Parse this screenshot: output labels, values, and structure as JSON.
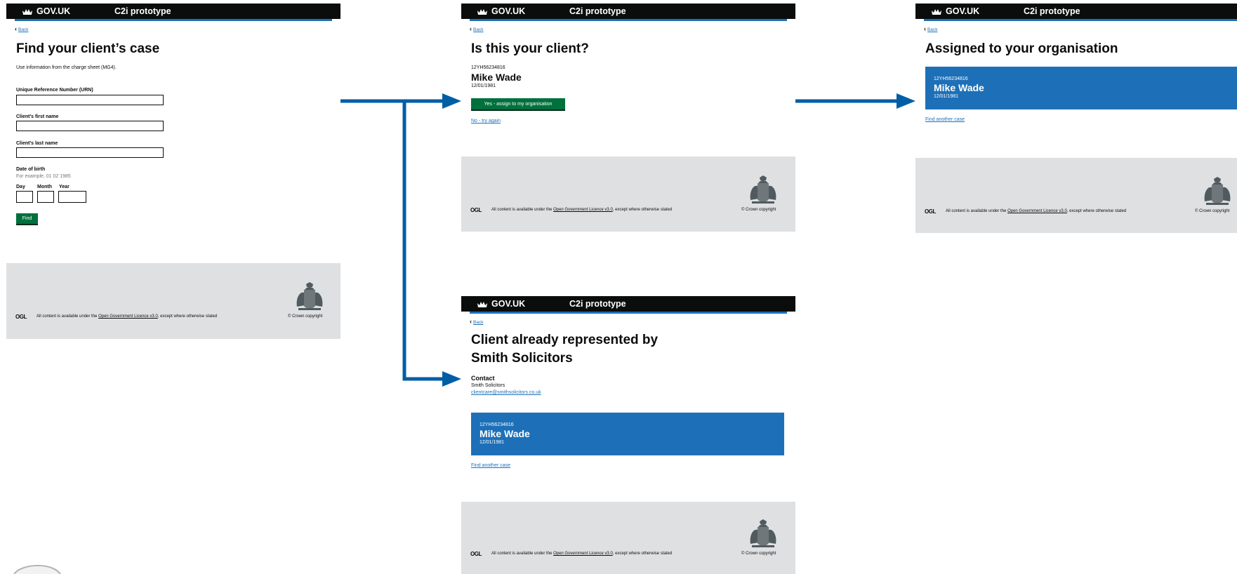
{
  "common": {
    "logo": "GOV.UK",
    "service": "C2i prototype",
    "back": "Back",
    "ogl": "OGL",
    "licence_before": "All content is available under the ",
    "licence_link": "Open Government Licence v3.0",
    "licence_after": ", except where otherwise stated",
    "copyright": "© Crown copyright"
  },
  "find_screen": {
    "title": "Find your client’s case",
    "intro": "Use information from the charge sheet (MG4).",
    "urn_label": "Unique Reference Number (URN)",
    "first_name_label": "Client’s first name",
    "last_name_label": "Client’s last name",
    "dob_label": "Date of birth",
    "dob_hint": "For example, 01 02 1985",
    "day_label": "Day",
    "month_label": "Month",
    "year_label": "Year",
    "find_button": "Find"
  },
  "confirm_screen": {
    "title": "Is this your client?",
    "urn": "12YH56234816",
    "name": "Mike Wade",
    "dob": "12/01/1981",
    "yes_button": "Yes - assign to my organisation",
    "no_link": "No - try again"
  },
  "assigned_screen": {
    "title": "Assigned to your organisation",
    "urn": "12YH56234816",
    "name": "Mike Wade",
    "dob": "12/01/1981",
    "find_another": "Find another case"
  },
  "represented_screen": {
    "title_line1": "Client already represented by",
    "title_line2": "Smith Solicitors",
    "contact_heading": "Contact",
    "contact_firm": "Smith Solicitors",
    "contact_email": "clientcare@smithsolicitors.co.uk",
    "urn": "12YH56234816",
    "name": "Mike Wade",
    "dob": "12/01/1981",
    "find_another": "Find another case"
  },
  "colors": {
    "header": "#0b0c0c",
    "brand_blue": "#1d70b8",
    "connector_blue": "#005ea5",
    "button_green": "#00703c",
    "footer_grey": "#dee0e2"
  }
}
